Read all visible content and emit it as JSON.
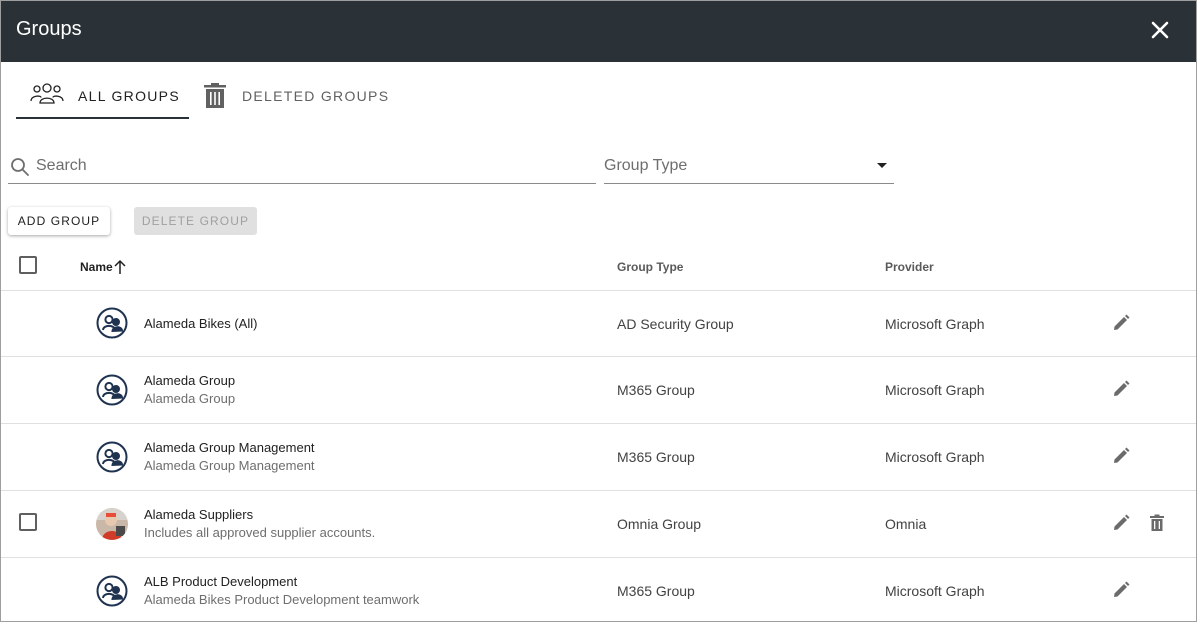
{
  "dialog": {
    "title": "Groups",
    "close_icon": "close-icon"
  },
  "tabs": [
    {
      "label": "ALL GROUPS",
      "icon": "people-group-icon",
      "active": true
    },
    {
      "label": "DELETED GROUPS",
      "icon": "trash-icon",
      "active": false
    }
  ],
  "search": {
    "placeholder": "Search",
    "value": "",
    "icon": "search-icon"
  },
  "group_type_filter": {
    "label": "Group Type",
    "value": ""
  },
  "toolbar": {
    "add_label": "ADD GROUP",
    "delete_label": "DELETE GROUP"
  },
  "table": {
    "headers": {
      "name": "Name",
      "group_type": "Group Type",
      "provider": "Provider"
    },
    "sort": {
      "column": "name",
      "direction": "ascending"
    },
    "rows": [
      {
        "name": "Alameda Bikes (All)",
        "description": "",
        "group_type": "AD Security Group",
        "provider": "Microsoft Graph",
        "selectable": false,
        "deletable": false,
        "avatar": "group-avatar-icon"
      },
      {
        "name": "Alameda Group",
        "description": "Alameda Group",
        "group_type": "M365 Group",
        "provider": "Microsoft Graph",
        "selectable": false,
        "deletable": false,
        "avatar": "group-avatar-icon"
      },
      {
        "name": "Alameda Group Management",
        "description": "Alameda Group Management",
        "group_type": "M365 Group",
        "provider": "Microsoft Graph",
        "selectable": false,
        "deletable": false,
        "avatar": "group-avatar-icon"
      },
      {
        "name": "Alameda Suppliers",
        "description": "Includes all approved supplier accounts.",
        "group_type": "Omnia Group",
        "provider": "Omnia",
        "selectable": true,
        "deletable": true,
        "avatar": "photo-avatar"
      },
      {
        "name": "ALB Product Development",
        "description": "Alameda Bikes Product Development teamwork",
        "group_type": "M365 Group",
        "provider": "Microsoft Graph",
        "selectable": false,
        "deletable": false,
        "avatar": "group-avatar-icon"
      }
    ]
  },
  "colors": {
    "header_bg": "#2b3237",
    "icon_navy": "#1f3350",
    "action_gray": "#6b6b6b"
  }
}
